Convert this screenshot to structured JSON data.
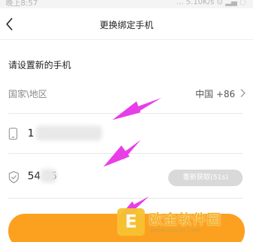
{
  "status_bar": {
    "time": "晚上8:57",
    "network": "... 5.10K/s ⊙ ▂▄ ◌"
  },
  "nav": {
    "title": "更换绑定手机",
    "back_icon": "chevron-left-icon"
  },
  "form": {
    "heading": "请设置新的手机",
    "country_label": "国家\\地区",
    "country_value": "中国 +86",
    "phone_value": "1",
    "code_value": "54     25",
    "resend_label": "重新获取(51s)"
  },
  "submit": {
    "color": "#fca11f"
  },
  "annotation": {
    "arrow_color": "#e83ee8"
  },
  "watermark": {
    "logo_char": "E",
    "name": "欧金软件园",
    "url": "www.ouxjin.com"
  }
}
